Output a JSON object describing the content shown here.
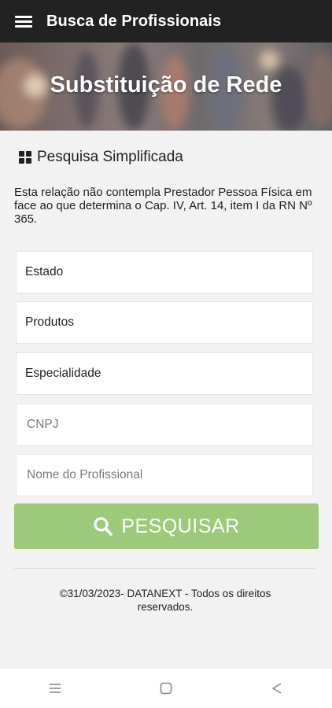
{
  "app": {
    "title": "Busca de Profissionais"
  },
  "hero": {
    "title": "Substituição de Rede"
  },
  "section": {
    "title": "Pesquisa Simplificada"
  },
  "notice": "Esta relação não contempla Prestador Pessoa Física em face ao que determina o Cap. IV, Art. 14, item I da RN Nº 365.",
  "form": {
    "estado": "Estado",
    "produtos": "Produtos",
    "especialidade": "Especialidade",
    "cnpj_placeholder": "CNPJ",
    "nome_placeholder": "Nome do Profissional"
  },
  "search_button": {
    "label": "PESQUISAR"
  },
  "footer": "©31/03/2023- DATANEXT - Todos os direitos reservados.",
  "colors": {
    "appbar": "#222222",
    "button": "#9dc97a",
    "background": "#f2f2f2"
  }
}
